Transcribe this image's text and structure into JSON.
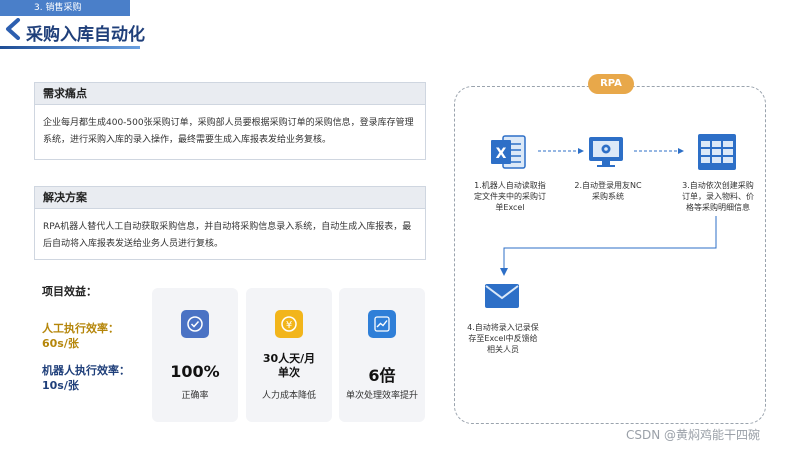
{
  "header": {
    "section_tab": "3. 销售采购",
    "title": "采购入库自动化"
  },
  "pain": {
    "heading": "需求痛点",
    "body": "企业每月都生成400-500张采购订单，采购部人员要根据采购订单的采购信息，登录库存管理系统，进行采购入库的录入操作，最终需要生成入库报表发给业务复核。"
  },
  "solution": {
    "heading": "解决方案",
    "body": "RPA机器人替代人工自动获取采购信息，并自动将采购信息录入系统，自动生成入库报表，最后自动将入库报表发送给业务人员进行复核。"
  },
  "benefits": {
    "label": "项目效益：",
    "human_title": "人工执行效率：",
    "human_value": "60s/张",
    "robot_title": "机器人执行效率：",
    "robot_value": "10s/张",
    "cards": [
      {
        "value": "100%",
        "caption": "正确率",
        "icon": "check-icon",
        "color": "#4a72c4"
      },
      {
        "value_line1": "30人天/月",
        "value_line2": "单次",
        "caption": "人力成本降低",
        "icon": "yuan-icon",
        "color": "#f2b51b"
      },
      {
        "value": "6倍",
        "caption": "单次处理效率提升",
        "icon": "chart-trend-icon",
        "color": "#2f7fd8"
      }
    ]
  },
  "rpa": {
    "badge": "RPA",
    "steps": [
      {
        "lines": [
          "1.机器人自动读取指",
          "定文件夹中的采购订",
          "单Excel"
        ],
        "icon": "excel-icon"
      },
      {
        "lines": [
          "2.自动登录用友NC",
          "采购系统"
        ],
        "icon": "monitor-gear-icon"
      },
      {
        "lines": [
          "3.自动依次创建采购",
          "订单，录入物料、价",
          "格等采购明细信息"
        ],
        "icon": "table-grid-icon"
      },
      {
        "lines": [
          "4.自动将录入记录保",
          "存至Excel中反馈给",
          "相关人员"
        ],
        "icon": "mail-icon"
      }
    ],
    "colors": {
      "primary": "#2d6fc7",
      "badge": "#e8a84a"
    }
  },
  "watermark": "CSDN @黄焖鸡能干四碗"
}
